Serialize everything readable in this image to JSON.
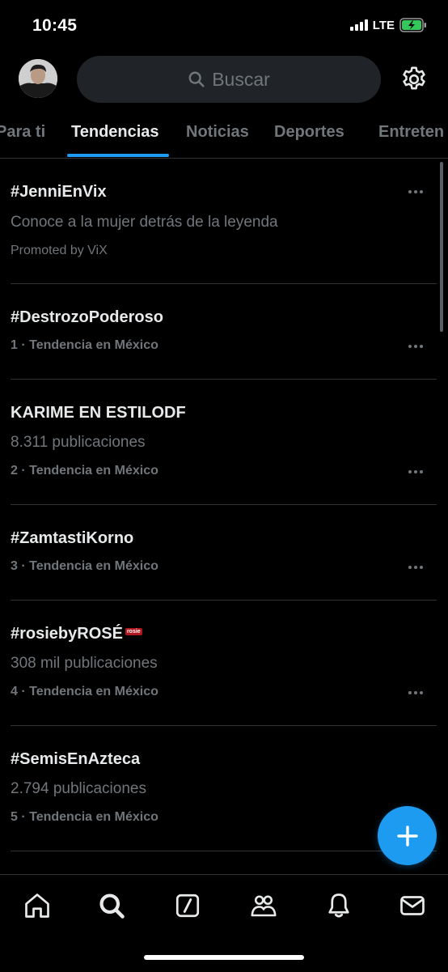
{
  "status_bar": {
    "time": "10:45",
    "network": "LTE"
  },
  "header": {
    "search_placeholder": "Buscar",
    "icons": [
      "avatar",
      "search-icon",
      "gear-icon"
    ]
  },
  "tabs": [
    {
      "label": "Para ti",
      "active": false
    },
    {
      "label": "Tendencias",
      "active": true
    },
    {
      "label": "Noticias",
      "active": false
    },
    {
      "label": "Deportes",
      "active": false
    },
    {
      "label": "Entreten",
      "active": false
    }
  ],
  "trends": [
    {
      "title": "#JenniEnVix",
      "subtitle": "Conoce a la mujer detrás de la leyenda",
      "meta": "Promoted by ViX"
    },
    {
      "title": "#DestrozoPoderoso",
      "meta": "1 · Tendencia en México"
    },
    {
      "title": "KARIME EN ESTILODF",
      "subtitle": "8.311 publicaciones",
      "meta": "2 · Tendencia en México"
    },
    {
      "title": "#ZamtastiKorno",
      "meta": "3 · Tendencia en México"
    },
    {
      "title": "#rosiebyROSÉ",
      "badge": "rosie",
      "subtitle": "308 mil publicaciones",
      "meta": "4 · Tendencia en México"
    },
    {
      "title": "#SemisEnAzteca",
      "subtitle": "2.794 publicaciones",
      "meta": "5 · Tendencia en México"
    }
  ],
  "fab": {
    "icon": "plus-icon"
  },
  "bottom_nav": [
    "home-icon",
    "search-icon",
    "grok-icon",
    "communities-icon",
    "notifications-icon",
    "messages-icon"
  ],
  "colors": {
    "accent": "#1d9bf0",
    "background": "#000000",
    "muted": "#71767b",
    "divider": "#2f3336"
  }
}
